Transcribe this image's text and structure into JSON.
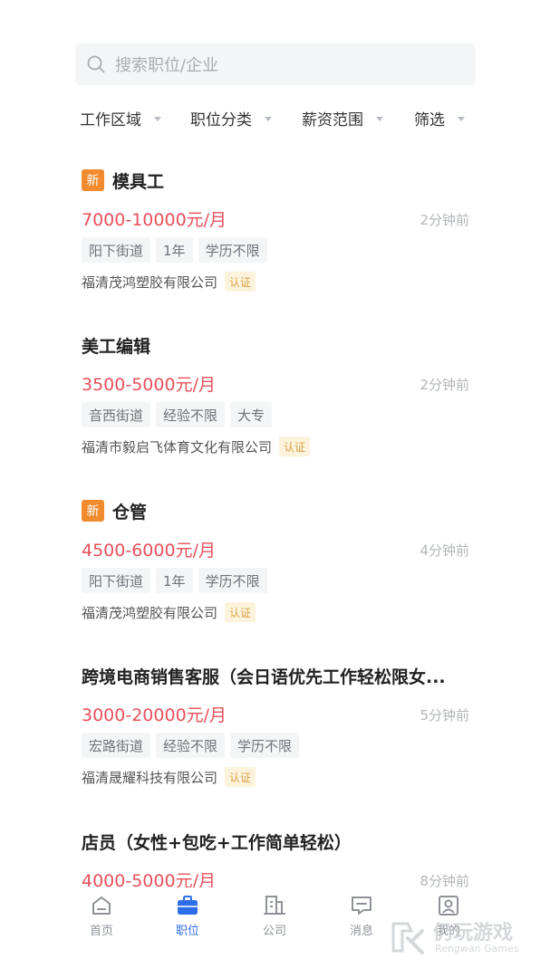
{
  "search": {
    "placeholder": "搜索职位/企业"
  },
  "filters": [
    "工作区域",
    "职位分类",
    "薪资范围",
    "筛选"
  ],
  "jobs": [
    {
      "new": true,
      "new_label": "新",
      "title": "模具工",
      "salary": "7000-10000元/月",
      "time": "2分钟前",
      "tags": [
        "阳下街道",
        "1年",
        "学历不限"
      ],
      "company": "福清茂鸿塑胶有限公司",
      "cert": "认证"
    },
    {
      "new": false,
      "new_label": "",
      "title": "美工编辑",
      "salary": "3500-5000元/月",
      "time": "2分钟前",
      "tags": [
        "音西街道",
        "经验不限",
        "大专"
      ],
      "company": "福清市毅启飞体育文化有限公司",
      "cert": "认证"
    },
    {
      "new": true,
      "new_label": "新",
      "title": "仓管",
      "salary": "4500-6000元/月",
      "time": "4分钟前",
      "tags": [
        "阳下街道",
        "1年",
        "学历不限"
      ],
      "company": "福清茂鸿塑胶有限公司",
      "cert": "认证"
    },
    {
      "new": false,
      "new_label": "",
      "title": "跨境电商销售客服（会日语优先工作轻松限女...",
      "salary": "3000-20000元/月",
      "time": "5分钟前",
      "tags": [
        "宏路街道",
        "经验不限",
        "学历不限"
      ],
      "company": "福清晟耀科技有限公司",
      "cert": "认证"
    },
    {
      "new": false,
      "new_label": "",
      "title": "店员（女性+包吃+工作简单轻松）",
      "salary": "4000-5000元/月",
      "time": "8分钟前",
      "tags": [],
      "company": "",
      "cert": ""
    }
  ],
  "tabbar": {
    "items": [
      {
        "label": "首页",
        "icon": "home-icon",
        "active": false
      },
      {
        "label": "职位",
        "icon": "briefcase-icon",
        "active": true
      },
      {
        "label": "公司",
        "icon": "building-icon",
        "active": false
      },
      {
        "label": "消息",
        "icon": "message-icon",
        "active": false
      },
      {
        "label": "我的",
        "icon": "profile-icon",
        "active": false
      }
    ]
  },
  "watermark": {
    "title": "仍玩游戏",
    "subtitle": "Rengwan Games"
  },
  "colors": {
    "accent": "#2e6de8",
    "salary": "#e8505b",
    "new_badge": "#f28a2e",
    "cert_bg": "#fdf3dc",
    "cert_text": "#d8a24a"
  }
}
